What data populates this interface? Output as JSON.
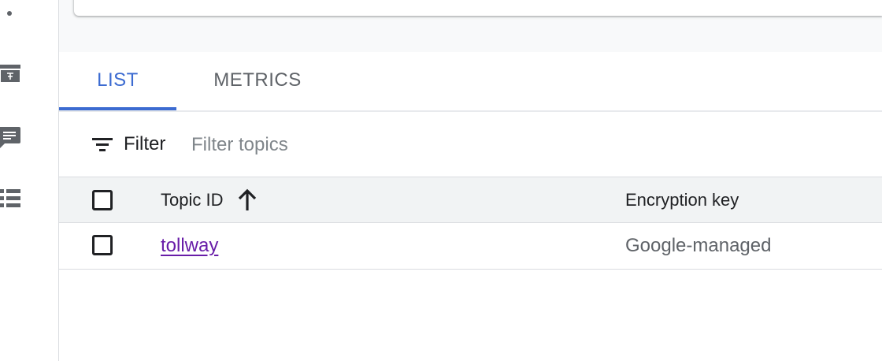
{
  "tabs": [
    {
      "label": "LIST",
      "active": true
    },
    {
      "label": "METRICS",
      "active": false
    }
  ],
  "filter": {
    "label": "Filter",
    "placeholder": "Filter topics"
  },
  "table": {
    "headers": {
      "topic_id": "Topic ID",
      "encryption_key": "Encryption key"
    },
    "sort": {
      "column": "topic_id",
      "direction": "ascending",
      "icon": "arrow-up-icon"
    },
    "rows": [
      {
        "topic_id": "tollway",
        "encryption_key": "Google-managed"
      }
    ]
  },
  "sidebar_icons": [
    "dot-icon",
    "storage-icon",
    "chat-icon",
    "list-icon"
  ],
  "colors": {
    "accent": "#3c6bd1",
    "link_visited": "#681da8",
    "header_bg": "#f1f3f4",
    "band_bg": "#f8f9fa"
  }
}
